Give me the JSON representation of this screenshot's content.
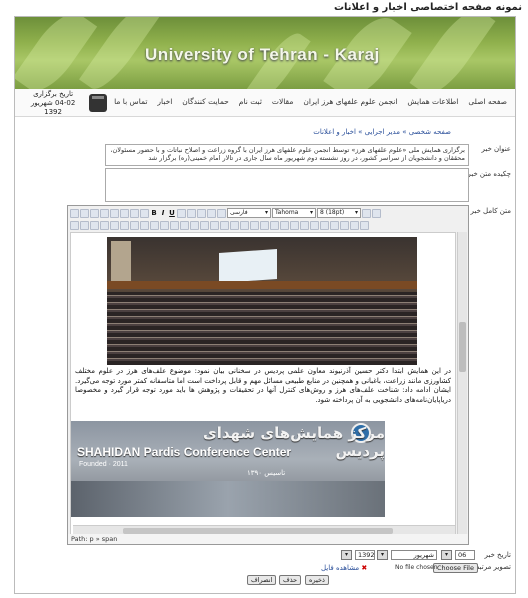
{
  "caption": "نمونه صفحه اختصاصی اخبار و اعلانات",
  "header": {
    "banner_title": "University of Tehran - Karaj",
    "date_label": "تاریخ برگزاری",
    "date_value": "04-02 شهریور 1392"
  },
  "nav": {
    "items": [
      "صفحه اصلی",
      "اطلاعات همایش",
      "انجمن علوم علفهای هرز ایران",
      "مقالات",
      "ثبت نام",
      "حمایت کنندگان",
      "اخبار",
      "تماس با ما"
    ]
  },
  "breadcrumb": "صفحه شخصی » مدیر اجرایی » اخبار و اعلانات",
  "form": {
    "title_label": "عنوان خبر",
    "title_value": "برگزاری همایش ملی «علوم علفهای هرز» توسط انجمن علوم علفهای هرز ایران با گروه زراعت و اصلاح نباتات و با حضور مسئولان، محققان و دانشجویان از سراسر کشور، در روز نشسته دوم شهریور ماه سال جاری در تالار امام خمینی(ره) برگزار شد",
    "summary_label": "چکیده متن خبر",
    "full_label": "متن کامل خبر",
    "date_label": "تاریخ خبر",
    "image_label": "تصویر مرتبط",
    "day_value": "06",
    "month_value": "شهریور",
    "year_value": "1392",
    "file_status": "No file chosen",
    "file_button": "Choose File",
    "view_file": "مشاهده فایل",
    "save_button": "ذخیره",
    "delete_button": "حذف",
    "cancel_button": "انصراف"
  },
  "editor": {
    "font_select": "Tahoma",
    "size_select": "8 (18pt)",
    "style_select": "فارسی",
    "paragraph": "در این همایش ابتدا دکتر حسین آذرنیوند معاون علمی پردیس در سخنانی بیان نمود: موضوع علف‌های هرز در علوم مختلف کشاورزی مانند زراعت، باغبانی و همچنین در منابع طبیعی مسائل مهم و قابل پرداخت است اما متاسفانه کمتر مورد توجه می‌گیرد. ایشان ادامه داد: شناخت علف‌های هرز و روش‌های کنترل آنها در تحقیقات و پژوهش ها باید مورد توجه قرار گیرد و مخصوصا دریاپایان‌نامه‌های دانشجویی به آن پرداخته شود.",
    "photo2_fa": "مرکز همایش‌های شهدای پردیس",
    "photo2_en": "SHAHIDAN Pardis Conference Center",
    "photo2_founded": "Founded · 2011",
    "photo2_year": "تاسیس ۱۳۹۰",
    "path": "Path: p » span"
  }
}
